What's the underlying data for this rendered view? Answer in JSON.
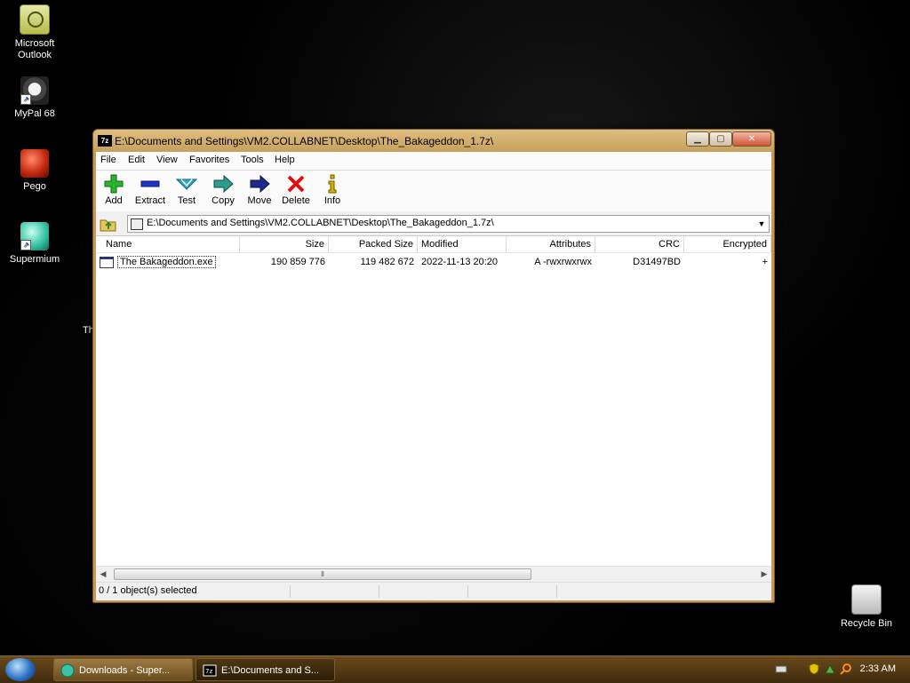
{
  "desktop": {
    "icons": [
      {
        "label": "Microsoft\nOutlook"
      },
      {
        "label": "MyPal 68"
      },
      {
        "label": "Pego"
      },
      {
        "label": "Supermium"
      },
      {
        "label": "Recycle Bin"
      }
    ],
    "partial_label": "The"
  },
  "window": {
    "title": "E:\\Documents and Settings\\VM2.COLLABNET\\Desktop\\The_Bakageddon_1.7z\\",
    "app_icon_text": "7z",
    "menu": [
      "File",
      "Edit",
      "View",
      "Favorites",
      "Tools",
      "Help"
    ],
    "toolbar": [
      {
        "label": "Add",
        "icon": "add-icon",
        "color": "#2db42d"
      },
      {
        "label": "Extract",
        "icon": "extract-icon",
        "color": "#1f33c9"
      },
      {
        "label": "Test",
        "icon": "test-icon",
        "color": "#2aa9c9"
      },
      {
        "label": "Copy",
        "icon": "copy-icon",
        "color": "#2e9c8c"
      },
      {
        "label": "Move",
        "icon": "move-icon",
        "color": "#1b2a8c"
      },
      {
        "label": "Delete",
        "icon": "delete-icon",
        "color": "#e01010"
      },
      {
        "label": "Info",
        "icon": "info-icon",
        "color": "#d4b400"
      }
    ],
    "address": "E:\\Documents and Settings\\VM2.COLLABNET\\Desktop\\The_Bakageddon_1.7z\\",
    "columns": [
      "Name",
      "Size",
      "Packed Size",
      "Modified",
      "Attributes",
      "CRC",
      "Encrypted"
    ],
    "rows": [
      {
        "name": "The Bakageddon.exe",
        "size": "190 859 776",
        "packed_size": "119 482 672",
        "modified": "2022-11-13 20:20",
        "attributes": "A -rwxrwxrwx",
        "crc": "D31497BD",
        "encrypted": "+"
      }
    ],
    "status": "0 / 1 object(s) selected"
  },
  "taskbar": {
    "buttons": [
      {
        "label": "Downloads - Super...",
        "active": false
      },
      {
        "label": "E:\\Documents and S...",
        "active": true
      }
    ],
    "clock": "2:33 AM"
  }
}
